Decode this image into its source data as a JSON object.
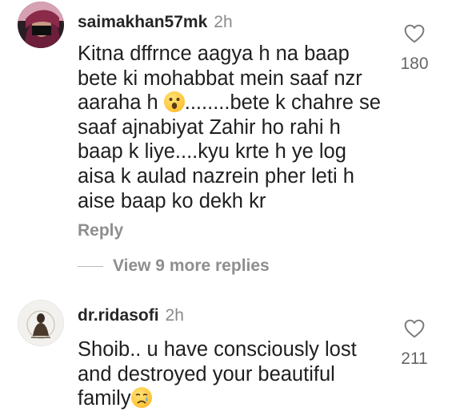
{
  "comments": [
    {
      "author": "saimakhan57mk",
      "time": "2h",
      "lines": [
        "Kitna dffrnce aagya h na baap",
        "bete ki mohabbat mein saaf nzr",
        "aaraha h ",
        "saaf ajnabiyat Zahir ho rahi h",
        "baap k liye....kyu krte h ye log",
        "aisa k aulad nazrein pher leti h",
        "aise baap ko dekh kr"
      ],
      "line3_suffix": "........bete k chahre se",
      "emoji": "surprised-face",
      "likes": "180",
      "reply_label": "Reply",
      "avatar_icon": "profile-photo"
    },
    {
      "author": "dr.ridasofi",
      "time": "2h",
      "lines": [
        "Shoib.. u have consciously lost",
        "and destroyed your beautiful",
        "family"
      ],
      "emoji": "crying-face",
      "likes": "211",
      "avatar_icon": "profile-photo"
    }
  ],
  "view_replies": "View 9 more replies",
  "colors": {
    "text": "#1f1f1f",
    "muted": "#8e8e8e",
    "like_count": "#666666"
  }
}
